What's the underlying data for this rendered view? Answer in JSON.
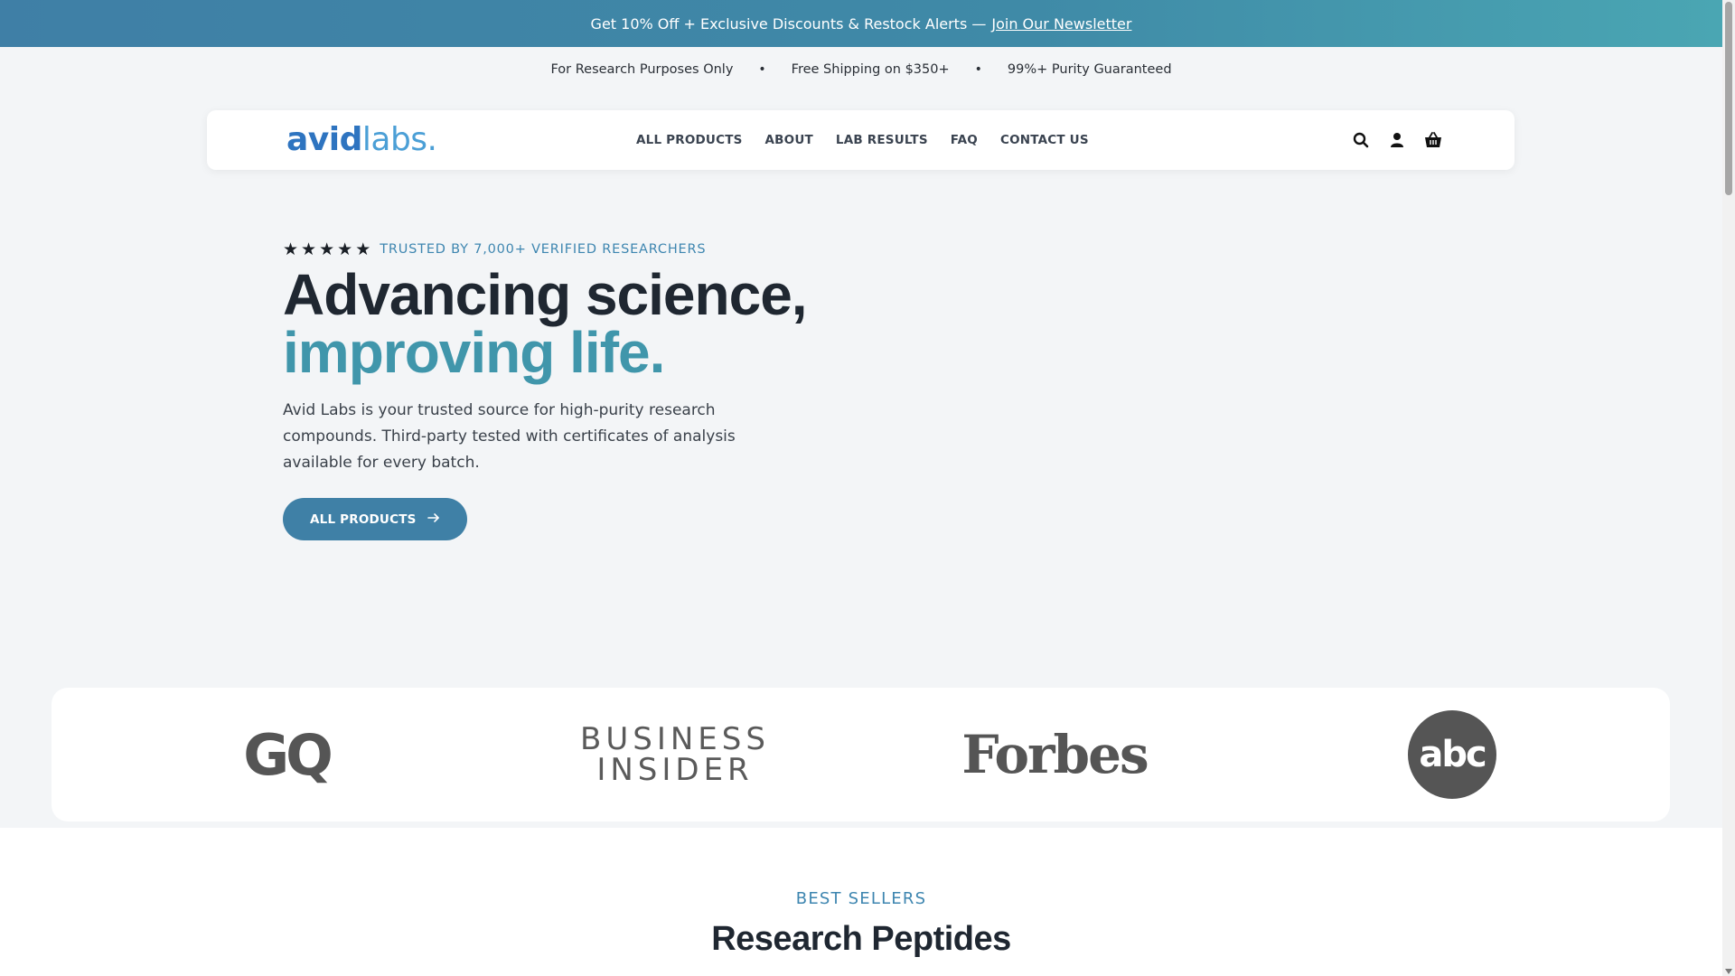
{
  "promo_bar": {
    "text": "Get 10% Off + Exclusive Discounts & Restock Alerts —",
    "link_label": "Join Our Newsletter"
  },
  "trust_strip": {
    "items": [
      "For Research Purposes Only",
      "Free Shipping on $350+",
      "99%+ Purity Guaranteed"
    ],
    "separator": "•"
  },
  "header": {
    "logo_bold": "avid",
    "logo_light": "labs.",
    "nav": [
      "ALL PRODUCTS",
      "ABOUT",
      "LAB RESULTS",
      "FAQ",
      "CONTACT US"
    ],
    "icons": [
      "search-icon",
      "account-icon",
      "cart-icon"
    ]
  },
  "hero": {
    "star_count": 5,
    "trusted_label": "TRUSTED BY 7,000+ VERIFIED RESEARCHERS",
    "title_line1": "Advancing science,",
    "title_line2": "improving life.",
    "description": "Avid Labs is your trusted source for high-purity research compounds. Third-party tested with certificates of analysis available for every batch.",
    "cta_label": "ALL PRODUCTS"
  },
  "press": {
    "logos": [
      "GQ",
      "BUSINESS INSIDER",
      "Forbes",
      "abc"
    ]
  },
  "best_sellers": {
    "eyebrow": "BEST SELLERS",
    "title": "Research Peptides"
  },
  "colors": {
    "brand_blue": "#2e74c0",
    "accent_teal": "#4096ab",
    "button": "#3f80a6",
    "eyebrow": "#3e86b0"
  }
}
